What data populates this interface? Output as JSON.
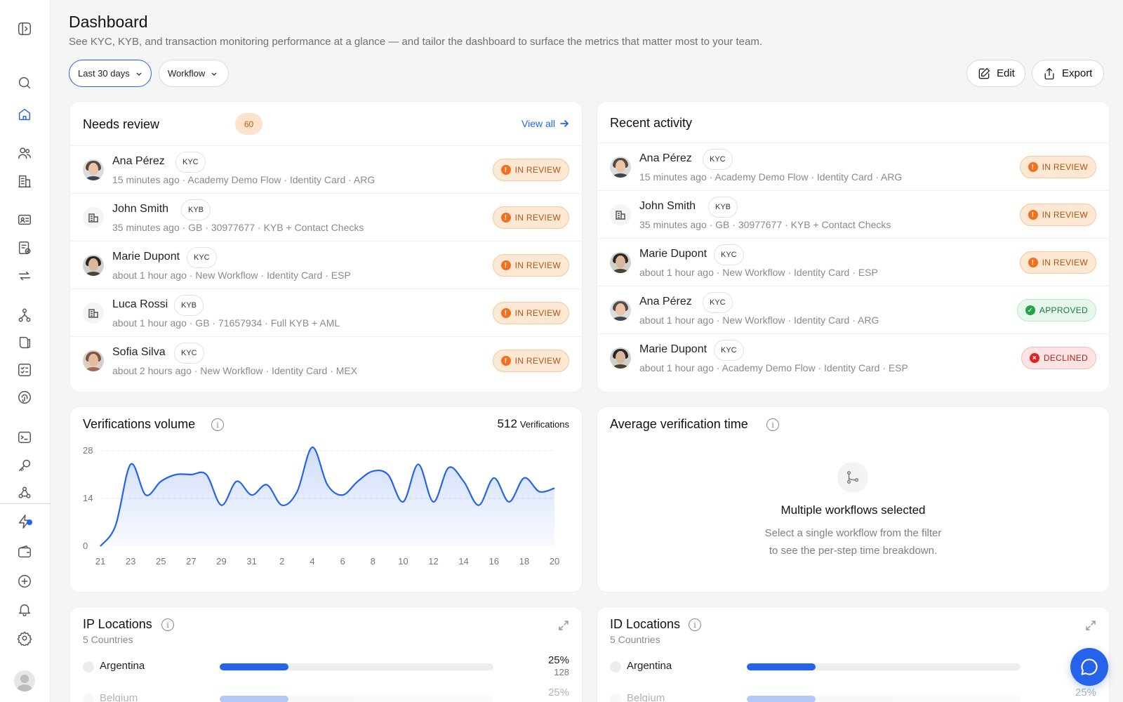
{
  "header": {
    "title": "Dashboard",
    "subtitle": "See KYC, KYB, and transaction monitoring performance at a glance — and tailor the dashboard to surface the metrics that matter most to your team."
  },
  "filters": {
    "date_range": "Last 30 days",
    "workflow": "Workflow"
  },
  "actions": {
    "edit": "Edit",
    "export": "Export"
  },
  "needs_review": {
    "title": "Needs review",
    "count": "60",
    "view_all": "View all",
    "rows": [
      {
        "name": "Ana Pérez",
        "type": "KYC",
        "meta": "15 minutes ago · Academy Demo Flow · Identity Card · ARG",
        "status": "IN REVIEW"
      },
      {
        "name": "John Smith",
        "type": "KYB",
        "meta": "35 minutes ago · GB · 30977677 · KYB + Contact Checks",
        "status": "IN REVIEW"
      },
      {
        "name": "Marie Dupont",
        "type": "KYC",
        "meta": "about 1 hour ago · New Workflow · Identity Card · ESP",
        "status": "IN REVIEW"
      },
      {
        "name": "Luca Rossi",
        "type": "KYB",
        "meta": "about 1 hour ago · GB · 71657934 · Full KYB + AML",
        "status": "IN REVIEW"
      },
      {
        "name": "Sofia Silva",
        "type": "KYC",
        "meta": "about 2 hours ago · New Workflow · Identity Card · MEX",
        "status": "IN REVIEW"
      }
    ]
  },
  "recent_activity": {
    "title": "Recent activity",
    "rows": [
      {
        "name": "Ana Pérez",
        "type": "KYC",
        "meta": "15 minutes ago · Academy Demo Flow · Identity Card · ARG",
        "status": "IN REVIEW"
      },
      {
        "name": "John Smith",
        "type": "KYB",
        "meta": "35 minutes ago · GB · 30977677 · KYB + Contact Checks",
        "status": "IN REVIEW"
      },
      {
        "name": "Marie Dupont",
        "type": "KYC",
        "meta": "about 1 hour ago · New Workflow · Identity Card · ESP",
        "status": "IN REVIEW"
      },
      {
        "name": "Ana Pérez",
        "type": "KYC",
        "meta": "about 1 hour ago · New Workflow · Identity Card · ARG",
        "status": "APPROVED"
      },
      {
        "name": "Marie Dupont",
        "type": "KYC",
        "meta": "about 1 hour ago · Academy Demo Flow · Identity Card · ESP",
        "status": "DECLINED"
      }
    ]
  },
  "verifications_volume": {
    "title": "Verifications volume",
    "total_value": "512",
    "total_label": "Verifications"
  },
  "avg_time": {
    "title": "Average verification time",
    "empty_title": "Multiple workflows selected",
    "empty_line1": "Select a single workflow from the filter",
    "empty_line2": "to see the per-step time breakdown."
  },
  "ip_locations": {
    "title": "IP Locations",
    "subtitle": "5 Countries",
    "rows": [
      {
        "country": "Argentina",
        "pct": "25%",
        "count": "128",
        "share": 0.25
      },
      {
        "country": "Belgium",
        "pct": "25%",
        "count": "",
        "share": 0.25
      }
    ]
  },
  "id_locations": {
    "title": "ID Locations",
    "subtitle": "5 Countries",
    "rows": [
      {
        "country": "Argentina",
        "pct": "",
        "count": "",
        "share": 0.25
      },
      {
        "country": "Belgium",
        "pct": "25%",
        "count": "",
        "share": 0.25
      }
    ]
  },
  "colors": {
    "accent": "#2563eb",
    "review": "#f0701b",
    "approved": "#22a34a",
    "declined": "#dc2626"
  },
  "chart_data": {
    "type": "area",
    "title": "Verifications volume",
    "x_ticks": [
      "21",
      "23",
      "25",
      "27",
      "29",
      "31",
      "2",
      "4",
      "6",
      "8",
      "10",
      "12",
      "14",
      "16",
      "18",
      "20"
    ],
    "y_ticks": [
      "0",
      "14",
      "28"
    ],
    "ylim": [
      0,
      28
    ],
    "series": [
      {
        "x": [
          21,
          22,
          23,
          24,
          25,
          26,
          27,
          28,
          29,
          30,
          31,
          32,
          33,
          34,
          35,
          36,
          37,
          38,
          39,
          40,
          41,
          42,
          43,
          44,
          45,
          46,
          47,
          48,
          49,
          50,
          51
        ],
        "values": [
          0,
          6,
          24,
          15,
          19,
          21,
          21,
          21,
          12,
          19,
          15,
          18,
          12,
          16,
          29,
          18,
          15,
          19,
          22,
          21,
          13,
          24,
          13,
          23,
          19,
          12,
          20,
          13,
          20,
          16,
          17
        ]
      }
    ]
  }
}
